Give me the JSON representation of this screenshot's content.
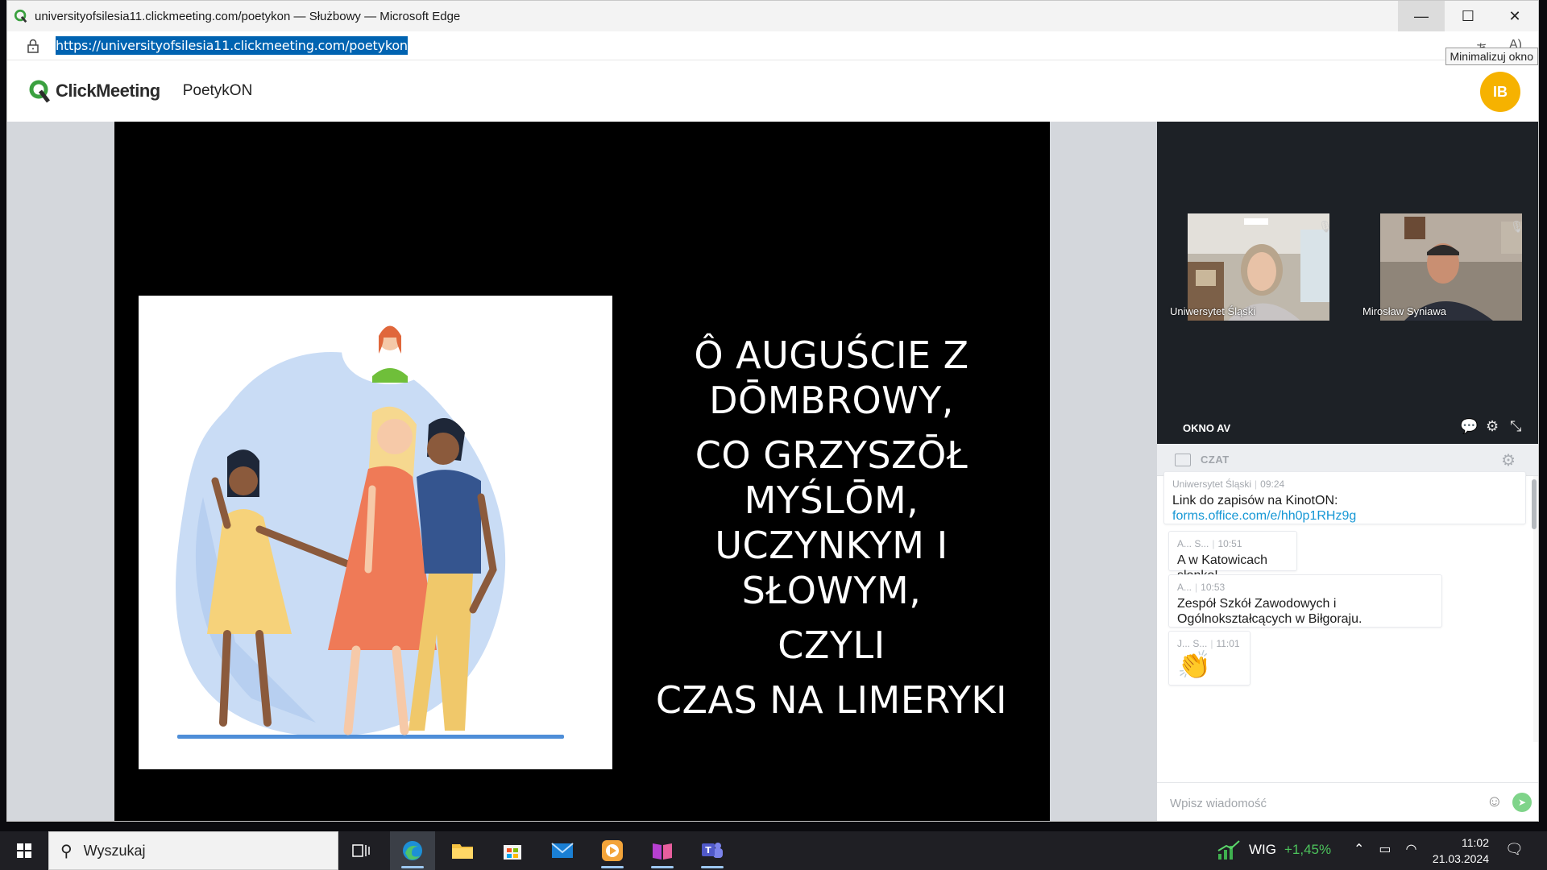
{
  "browser": {
    "title": "universityofsilesia11.clickmeeting.com/poetykon — Służbowy — Microsoft Edge",
    "url": "https://universityofsilesia11.clickmeeting.com/poetykon",
    "tooltip": "Minimalizuj okno"
  },
  "app": {
    "logo_text": "ClickMeeting",
    "room_name": "PoetykON",
    "avatar_initials": "IB"
  },
  "slide": {
    "lines": [
      "Ô AUGUŚCIE Z",
      "DŌMBROWY,",
      "CO GRZYSZŌŁ",
      "MYŚLŌM,",
      "UCZYNKYM I",
      "SŁOWYM,",
      "CZYLI",
      "CZAS NA LIMERYKI"
    ]
  },
  "av": {
    "label": "OKNO AV",
    "participants": [
      {
        "name": "Uniwersytet Śląski"
      },
      {
        "name": "Mirosław Syniawa"
      }
    ]
  },
  "chat": {
    "title": "CZAT",
    "messages": [
      {
        "author": "Uniwersytet Śląski",
        "time": "09:24",
        "text": "Link do zapisów na KinotON:",
        "link": "forms.office.com/e/hh0p1RHz9g"
      },
      {
        "author": "A... S...",
        "time": "10:51",
        "text": "A w Katowicach słonko!"
      },
      {
        "author": "A...",
        "time": "10:53",
        "text": "Zespół Szkół Zawodowych i Ogólnokształcących w Biłgoraju."
      },
      {
        "author": "J... S...",
        "time": "11:01",
        "text": "👏"
      }
    ],
    "input_placeholder": "Wpisz wiadomość"
  },
  "taskbar": {
    "search_text": "Wyszukaj",
    "stock_name": "WIG",
    "stock_change": "+1,45%",
    "time": "11:02",
    "date": "21.03.2024"
  }
}
